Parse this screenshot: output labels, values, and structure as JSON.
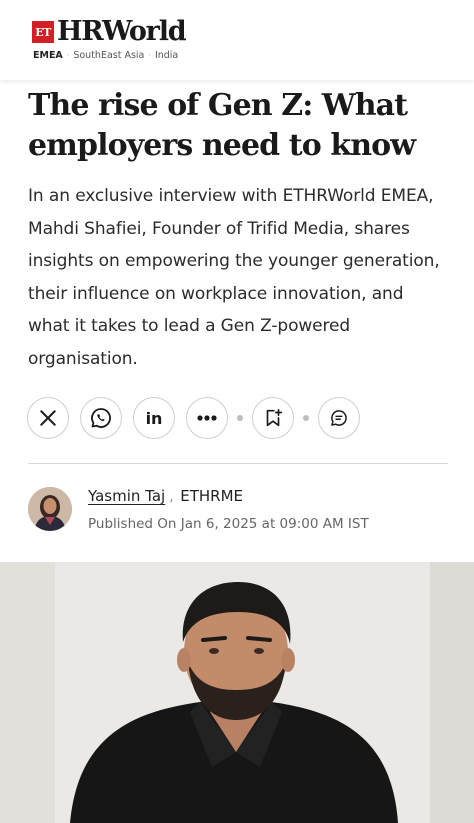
{
  "header": {
    "logo_et": "ET",
    "brand": "HRWorld",
    "regions": [
      "EMEA",
      "SouthEast Asia",
      "India"
    ],
    "active_region": "EMEA"
  },
  "article": {
    "title": "The rise of Gen Z: What employers need to know",
    "summary": "In an exclusive interview with ETHRWorld EMEA, Mahdi Shafiei, Founder of Trifid Media, shares insights on empowering the younger generation, their influence on workplace innovation, and what it takes to lead a Gen Z-powered organisation."
  },
  "share": {
    "buttons": [
      "x-icon",
      "whatsapp-icon",
      "linkedin-icon",
      "more-icon",
      "bookmark-add-icon",
      "comment-icon"
    ],
    "linkedin_text": "in"
  },
  "author": {
    "name": "Yasmin Taj",
    "separator": " ,",
    "org": "ETHRME",
    "published": "Published On Jan 6, 2025 at 09:00 AM IST"
  },
  "colors": {
    "brand_red": "#d32027",
    "text": "#1a1a1a",
    "muted": "#666666",
    "border": "#cfcfcf"
  }
}
